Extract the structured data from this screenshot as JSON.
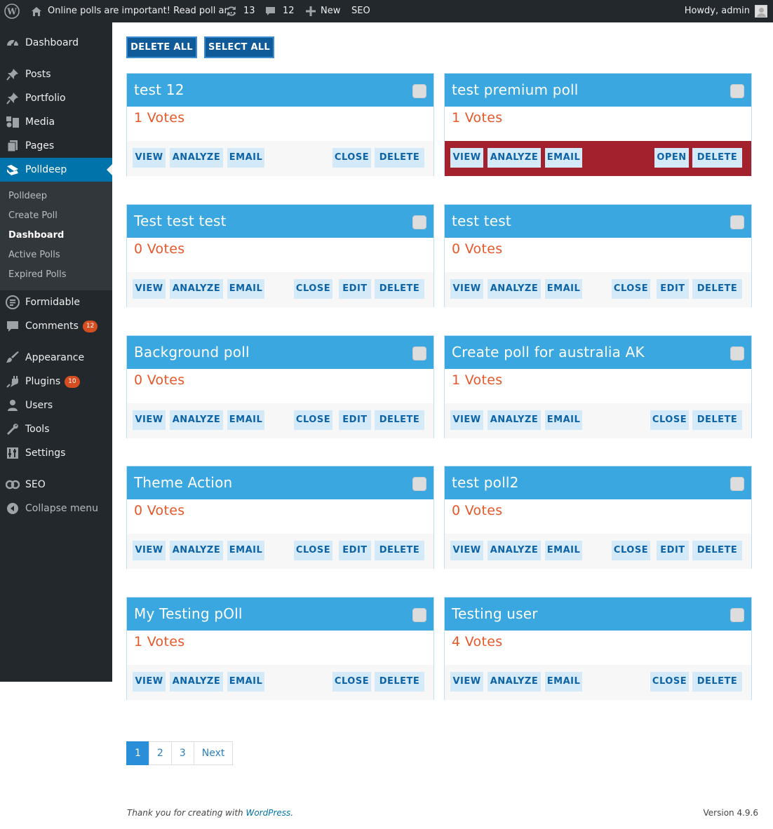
{
  "admin_bar": {
    "notice": "Online polls are important! Read poll ar...",
    "updates_count": "13",
    "comments_count": "12",
    "new_label": "New",
    "seo_label": "SEO",
    "greeting": "Howdy, admin"
  },
  "sidebar": {
    "items": [
      {
        "label": "Dashboard",
        "icon": "dashboard-icon"
      },
      {
        "label": "Posts",
        "icon": "pin-icon"
      },
      {
        "label": "Portfolio",
        "icon": "pin-icon"
      },
      {
        "label": "Media",
        "icon": "media-icon"
      },
      {
        "label": "Pages",
        "icon": "pages-icon"
      },
      {
        "label": "Polldeep",
        "icon": "polldeep-icon"
      },
      {
        "label": "Formidable",
        "icon": "formidable-icon"
      },
      {
        "label": "Comments",
        "icon": "comment-icon",
        "badge": "12"
      },
      {
        "label": "Appearance",
        "icon": "brush-icon"
      },
      {
        "label": "Plugins",
        "icon": "plug-icon",
        "badge": "10"
      },
      {
        "label": "Users",
        "icon": "user-icon"
      },
      {
        "label": "Tools",
        "icon": "wrench-icon"
      },
      {
        "label": "Settings",
        "icon": "settings-icon"
      },
      {
        "label": "SEO",
        "icon": "seo-icon"
      },
      {
        "label": "Collapse menu",
        "icon": "collapse-icon"
      }
    ],
    "submenu": [
      "Polldeep",
      "Create Poll",
      "Dashboard",
      "Active Polls",
      "Expired Polls"
    ]
  },
  "toolbar": {
    "delete_all": "DELETE ALL",
    "select_all": "SELECT ALL"
  },
  "actions": {
    "view": "VIEW",
    "analyze": "ANALYZE",
    "email": "EMAIL",
    "close": "CLOSE",
    "open": "OPEN",
    "edit": "EDIT",
    "delete": "DELETE"
  },
  "polls": [
    {
      "title": "test 12",
      "votes": "1 Votes"
    },
    {
      "title": "test premium poll",
      "votes": "1 Votes"
    },
    {
      "title": "Test test test",
      "votes": "0 Votes"
    },
    {
      "title": "test test",
      "votes": "0 Votes"
    },
    {
      "title": "Background poll",
      "votes": "0 Votes"
    },
    {
      "title": "Create poll for australia AK",
      "votes": "1 Votes"
    },
    {
      "title": "Theme Action",
      "votes": "0 Votes"
    },
    {
      "title": "test poll2",
      "votes": "0 Votes"
    },
    {
      "title": "My Testing pOll",
      "votes": "1 Votes"
    },
    {
      "title": "Testing user",
      "votes": "4 Votes"
    }
  ],
  "colors": {
    "expired_footer": "#a3202d",
    "card_header": "#3aa7e0",
    "votes_text": "#e8572a"
  },
  "pagination": [
    "1",
    "2",
    "3",
    "Next"
  ],
  "footer": {
    "thanks": "Thank you for creating with",
    "link": "WordPress",
    "period": ".",
    "version": "Version 4.9.6"
  }
}
